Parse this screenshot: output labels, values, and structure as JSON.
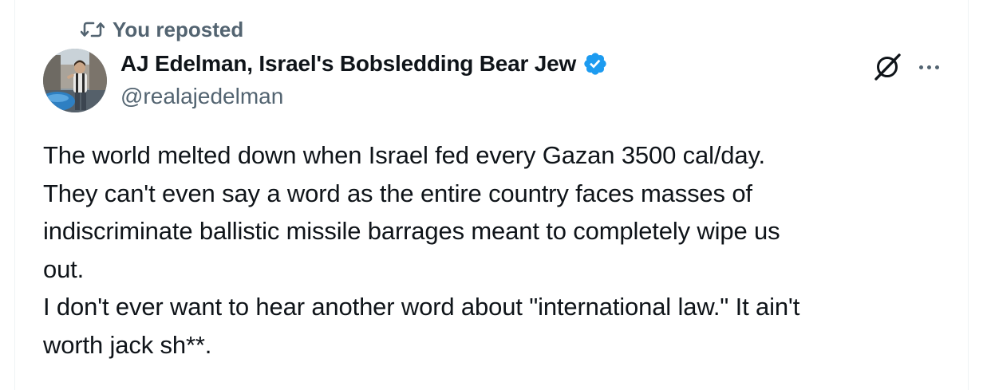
{
  "repost": {
    "label": "You reposted",
    "icon": "repost-icon"
  },
  "author": {
    "display_name": "AJ Edelman, Israel's Bobsledding Bear Jew",
    "handle": "@realajedelman",
    "verified": true,
    "verified_color": "#1d9bf0"
  },
  "actions": {
    "grok_icon": "grok-icon",
    "more_icon": "more-icon"
  },
  "tweet": {
    "lines": [
      "The world melted down when Israel fed every Gazan 3500 cal/day.",
      "They can't even say a word as the entire country faces masses of",
      "indiscriminate ballistic missile barrages meant to completely wipe us",
      "out.",
      "I don't ever want to hear another word about \"international law.\" It ain't",
      "worth jack sh**."
    ]
  },
  "colors": {
    "text_primary": "#0f1419",
    "text_secondary": "#536471",
    "accent": "#1d9bf0"
  }
}
